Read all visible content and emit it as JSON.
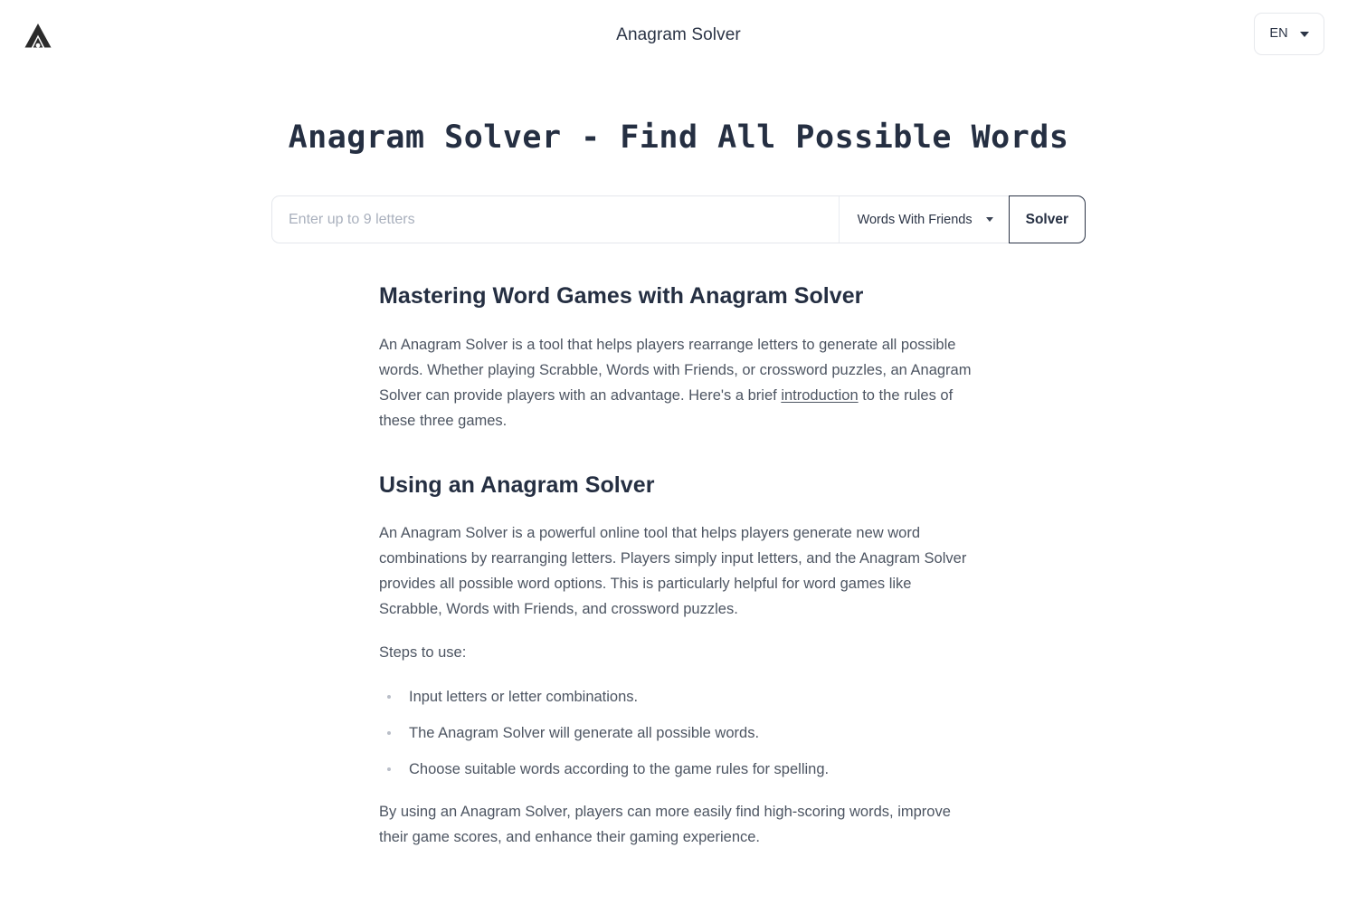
{
  "header": {
    "logo_icon": "mountain-a-logo-icon",
    "title": "Anagram Solver",
    "language": {
      "code": "EN",
      "caret_icon": "chevron-down-icon"
    }
  },
  "hero": {
    "title": "Anagram Solver - Find All Possible Words"
  },
  "search": {
    "placeholder": "Enter up to 9 letters",
    "value": "",
    "game_selected": "Words With Friends",
    "game_caret_icon": "chevron-down-icon",
    "submit_label": "Solver"
  },
  "article": {
    "section1": {
      "heading": "Mastering Word Games with Anagram Solver",
      "para_part1": "An Anagram Solver is a tool that helps players rearrange letters to generate all possible words. Whether playing Scrabble, Words with Friends, or crossword puzzles, an Anagram Solver can provide players with an advantage. Here's a brief ",
      "link_text": "introduction",
      "para_part2": " to the rules of these three games."
    },
    "section2": {
      "heading": "Using an Anagram Solver",
      "para1": "An Anagram Solver is a powerful online tool that helps players generate new word combinations by rearranging letters. Players simply input letters, and the Anagram Solver provides all possible word options. This is particularly helpful for word games like Scrabble, Words with Friends, and crossword puzzles.",
      "steps_intro": "Steps to use:",
      "steps": [
        "Input letters or letter combinations.",
        "The Anagram Solver will generate all possible words.",
        "Choose suitable words according to the game rules for spelling."
      ],
      "closing": "By using an Anagram Solver, players can more easily find high-scoring words, improve their game scores, and enhance their gaming experience."
    }
  },
  "colors": {
    "text_dark": "#252f42",
    "text_body": "#4d5562",
    "placeholder": "#a9b0bd",
    "border": "#e4e7ec",
    "background": "#ffffff"
  }
}
